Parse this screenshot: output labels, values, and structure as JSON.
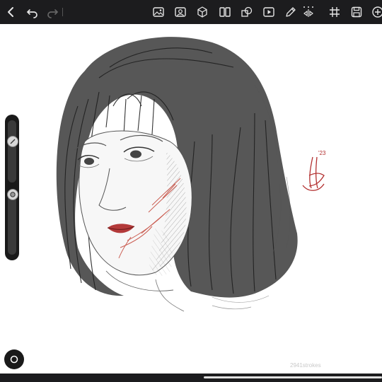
{
  "toolbar": {
    "left_tools": [
      "back-icon",
      "undo-icon",
      "redo-icon"
    ],
    "right_tools": [
      "gallery-icon",
      "reference-icon",
      "3d-icon",
      "split-icon",
      "shape-icon",
      "video-icon",
      "pen-icon",
      "symmetry-icon",
      "grid-icon",
      "save-icon",
      "add-icon"
    ]
  },
  "canvas": {
    "signature_year": "'23",
    "stroke_count": "2941strokes"
  },
  "sidebar": {
    "brush_size_level": 0.18,
    "opacity_level": 0.55
  },
  "colors": {
    "toolbar_bg": "#1c1c1e",
    "ink": "#2a2a2a",
    "blood_red": "#c0392b"
  }
}
